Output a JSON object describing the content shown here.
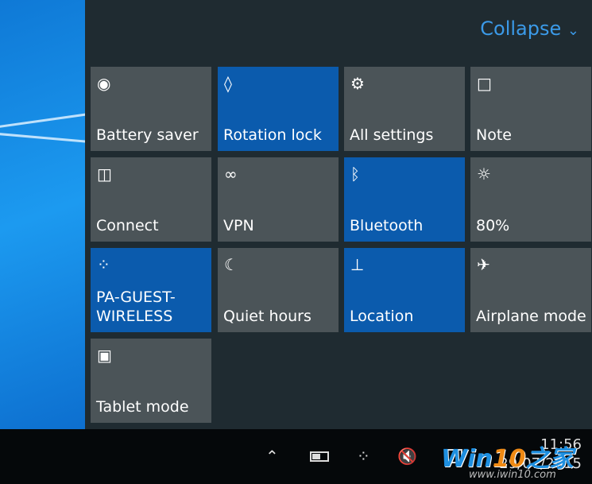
{
  "header": {
    "collapse_label": "Collapse",
    "collapse_icon": "chevron-down-icon"
  },
  "tiles": [
    {
      "label": "Battery saver",
      "icon": "battery-saver-icon",
      "active": false
    },
    {
      "label": "Rotation lock",
      "icon": "rotation-lock-icon",
      "active": true
    },
    {
      "label": "All settings",
      "icon": "gear-icon",
      "active": false
    },
    {
      "label": "Note",
      "icon": "note-icon",
      "active": false
    },
    {
      "label": "Connect",
      "icon": "connect-icon",
      "active": false
    },
    {
      "label": "VPN",
      "icon": "vpn-icon",
      "active": false
    },
    {
      "label": "Bluetooth",
      "icon": "bluetooth-icon",
      "active": true
    },
    {
      "label": "80%",
      "icon": "brightness-icon",
      "active": false
    },
    {
      "label": "PA-GUEST-\nWIRELESS",
      "icon": "wifi-icon",
      "active": true
    },
    {
      "label": "Quiet hours",
      "icon": "moon-icon",
      "active": false
    },
    {
      "label": "Location",
      "icon": "location-icon",
      "active": true
    },
    {
      "label": "Airplane mode",
      "icon": "airplane-icon",
      "active": false
    },
    {
      "label": "Tablet mode",
      "icon": "tablet-mode-icon",
      "active": false
    }
  ],
  "taskbar": {
    "time": "11:56",
    "date": "29/07/2015"
  },
  "watermark": {
    "brand_a": "Win",
    "brand_b": "10",
    "brand_c": "之家",
    "url": "www.iwin10.com"
  },
  "colors": {
    "active_tile": "#0b5bad",
    "tile": "#4b5458",
    "accent": "#3b9ae8"
  }
}
